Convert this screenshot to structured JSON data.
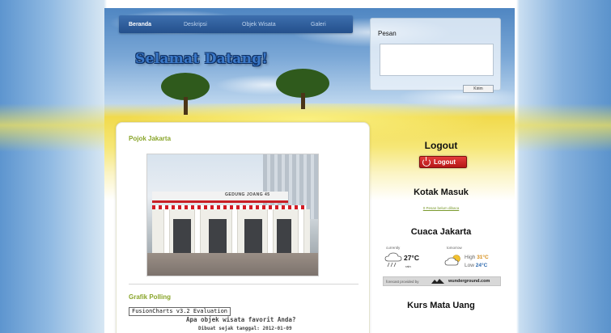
{
  "nav": {
    "items": [
      "Beranda",
      "Deskripsi",
      "Objek Wisata",
      "Galeri"
    ],
    "active": "Beranda"
  },
  "header": {
    "welcome": "Selamat Datang!"
  },
  "pesan": {
    "title": "Pesan",
    "send_label": "Kirim"
  },
  "content": {
    "section1_title": "Pojok Jakarta",
    "photo_sign": "GEDUNG JOANG 45",
    "section2_title": "Grafik Polling",
    "fusioncharts_label": "FusionCharts v3.2 Evaluation",
    "poll_question": "Apa objek wisata favorit Anda?",
    "poll_date": "Dibuat sejak tanggal: 2012-01-09"
  },
  "sidebar": {
    "logout_title": "Logout",
    "logout_button": "Logout",
    "inbox_title": "Kotak Masuk",
    "inbox_status": "0 Pesan belum dibaca",
    "weather_title": "Cuaca Jakarta",
    "weather": {
      "current_label": "currently",
      "current_temp": "27°C",
      "current_sub": "rain",
      "tomorrow_label": "tomorrow",
      "high_label": "High",
      "high_value": "31°C",
      "low_label": "Low",
      "low_value": "24°C",
      "provider_text": "forecast provided by",
      "provider_name": "wunderground.com"
    },
    "currency_title": "Kurs Mata Uang"
  },
  "colors": {
    "nav_bg": "#2b5a97",
    "welcome_text": "#3a78c8",
    "section_title": "#89a52a",
    "logout_button": "#c92424",
    "high_temp": "#d58b14",
    "low_temp": "#2f6bb0"
  }
}
